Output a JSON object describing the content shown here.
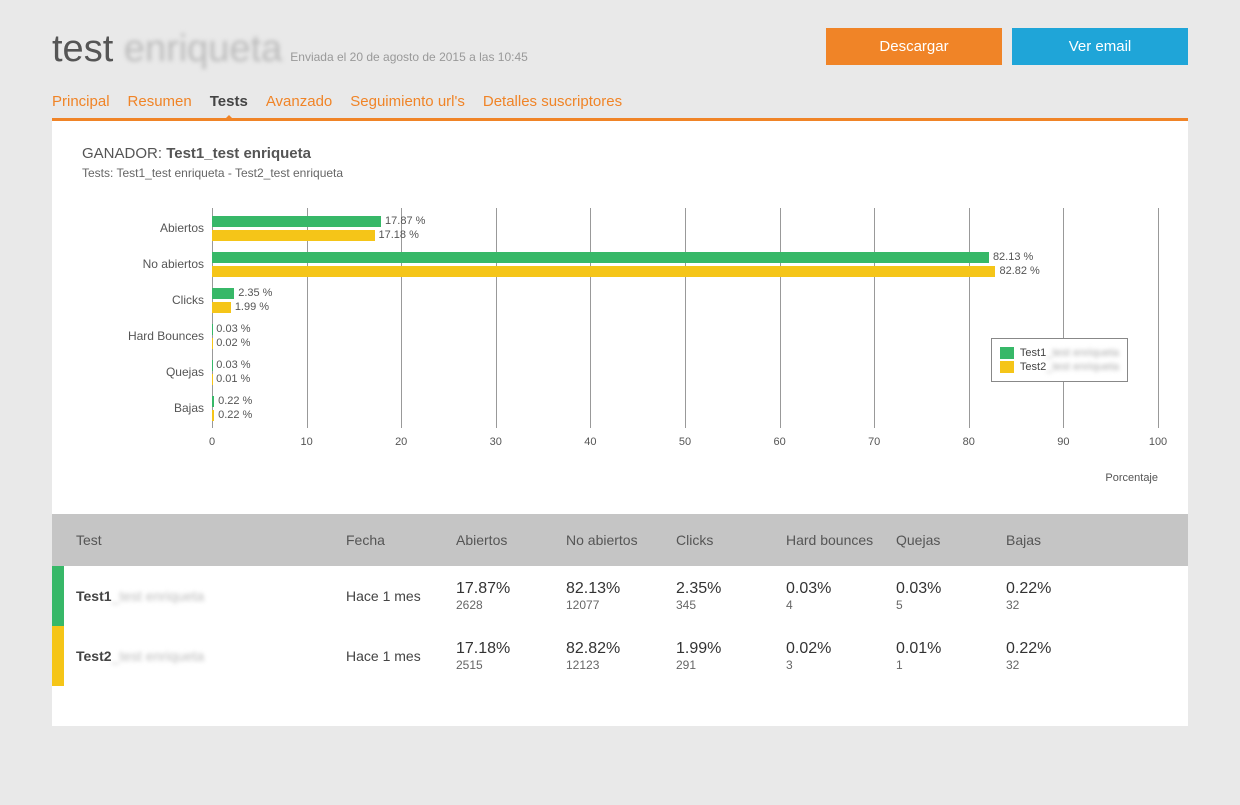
{
  "header": {
    "title_prefix": "test",
    "title_suffix_blur": "enriqueta",
    "subtitle": "Enviada el 20 de agosto de 2015 a las 10:45",
    "download_label": "Descargar",
    "view_email_label": "Ver email"
  },
  "tabs": [
    {
      "label": "Principal",
      "active": false
    },
    {
      "label": "Resumen",
      "active": false
    },
    {
      "label": "Tests",
      "active": true
    },
    {
      "label": "Avanzado",
      "active": false
    },
    {
      "label": "Seguimiento url's",
      "active": false
    },
    {
      "label": "Detalles suscriptores",
      "active": false
    }
  ],
  "panel": {
    "winner_prefix": "GANADOR:",
    "winner_name": "Test1_test enriqueta",
    "tests_line": "Tests: Test1_test enriqueta - Test2_test enriqueta"
  },
  "chart_data": {
    "type": "bar",
    "orientation": "horizontal",
    "categories": [
      "Abiertos",
      "No abiertos",
      "Clicks",
      "Hard Bounces",
      "Quejas",
      "Bajas"
    ],
    "series": [
      {
        "name": "Test1_test enriqueta",
        "values": [
          17.87,
          82.13,
          2.35,
          0.03,
          0.03,
          0.22
        ],
        "color": "#37b868"
      },
      {
        "name": "Test2_test enriqueta",
        "values": [
          17.18,
          82.82,
          1.99,
          0.02,
          0.01,
          0.22
        ],
        "color": "#f5c518"
      }
    ],
    "xlabel": "Porcentaje",
    "xlim": [
      0,
      100
    ],
    "xticks": [
      0,
      10,
      20,
      30,
      40,
      50,
      60,
      70,
      80,
      90,
      100
    ],
    "value_suffix": " %",
    "legend_position": "right"
  },
  "legend": {
    "s0_prefix": "Test1",
    "s0_blur": "_test enriqueta",
    "s1_prefix": "Test2",
    "s1_blur": "_test enriqueta"
  },
  "table": {
    "headers": {
      "test": "Test",
      "date": "Fecha",
      "opens": "Abiertos",
      "noopens": "No abiertos",
      "clicks": "Clicks",
      "hb": "Hard bounces",
      "complaints": "Quejas",
      "unsub": "Bajas"
    },
    "rows": [
      {
        "series": 0,
        "name_prefix": "Test1",
        "name_blur": "_test enriqueta",
        "date": "Hace 1 mes",
        "opens_p": "17.87%",
        "opens_n": "2628",
        "noopens_p": "82.13%",
        "noopens_n": "12077",
        "clicks_p": "2.35%",
        "clicks_n": "345",
        "hb_p": "0.03%",
        "hb_n": "4",
        "complaints_p": "0.03%",
        "complaints_n": "5",
        "unsub_p": "0.22%",
        "unsub_n": "32"
      },
      {
        "series": 1,
        "name_prefix": "Test2",
        "name_blur": "_test enriqueta",
        "date": "Hace 1 mes",
        "opens_p": "17.18%",
        "opens_n": "2515",
        "noopens_p": "82.82%",
        "noopens_n": "12123",
        "clicks_p": "1.99%",
        "clicks_n": "291",
        "hb_p": "0.02%",
        "hb_n": "3",
        "complaints_p": "0.01%",
        "complaints_n": "1",
        "unsub_p": "0.22%",
        "unsub_n": "32"
      }
    ]
  }
}
